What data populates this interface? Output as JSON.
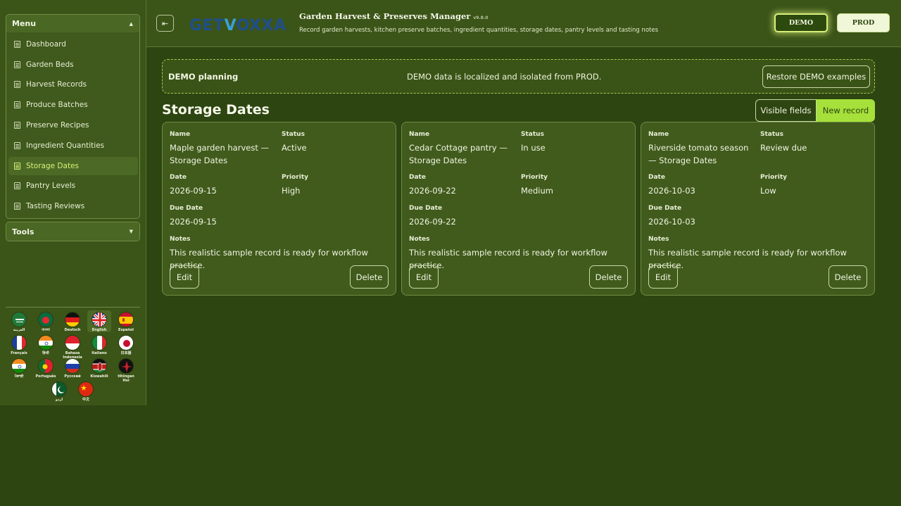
{
  "sidebar": {
    "menu_title": "Menu",
    "menu_items": [
      {
        "label": "Dashboard"
      },
      {
        "label": "Garden Beds"
      },
      {
        "label": "Harvest Records"
      },
      {
        "label": "Produce Batches"
      },
      {
        "label": "Preserve Recipes"
      },
      {
        "label": "Ingredient Quantities"
      },
      {
        "label": "Storage Dates",
        "active": true
      },
      {
        "label": "Pantry Levels"
      },
      {
        "label": "Tasting Reviews"
      }
    ],
    "tools_title": "Tools",
    "languages": [
      {
        "label": "العربية",
        "flag": "saudi-arabia"
      },
      {
        "label": "বাংলা",
        "flag": "bangladesh"
      },
      {
        "label": "Deutsch",
        "flag": "germany"
      },
      {
        "label": "English",
        "flag": "united-kingdom",
        "selected": true
      },
      {
        "label": "Español",
        "flag": "spain"
      },
      {
        "label": "Français",
        "flag": "france"
      },
      {
        "label": "हिन्दी",
        "flag": "india"
      },
      {
        "label": "Bahasa Indonesia",
        "flag": "indonesia"
      },
      {
        "label": "Italiano",
        "flag": "italy"
      },
      {
        "label": "日本語",
        "flag": "japan"
      },
      {
        "label": "ਪੰਜਾਬੀ",
        "flag": "india"
      },
      {
        "label": "Português",
        "flag": "portugal"
      },
      {
        "label": "Русский",
        "flag": "russia"
      },
      {
        "label": "Kiswahili",
        "flag": "kenya"
      },
      {
        "label": "tlhIngan Hol",
        "flag": "klingon"
      },
      {
        "label": "اردو",
        "flag": "pakistan"
      },
      {
        "label": "中文",
        "flag": "china"
      }
    ]
  },
  "header": {
    "logo_prefix": "GET",
    "logo_v": "V",
    "logo_suffix": "OXXA",
    "title": "Garden Harvest & Preserves Manager",
    "version": "v9.8.0",
    "subtitle": "Record garden harvests, kitchen preserve batches, ingredient quantities, storage dates, pantry levels and tasting notes",
    "demo_label": "DEMO",
    "prod_label": "PROD"
  },
  "notice": {
    "title": "DEMO planning",
    "message": "DEMO data is localized and isolated from PROD.",
    "restore_label": "Restore DEMO examples"
  },
  "section": {
    "title": "Storage Dates",
    "visible_fields_label": "Visible fields",
    "new_record_label": "New record"
  },
  "field_labels": {
    "name": "Name",
    "status": "Status",
    "date": "Date",
    "priority": "Priority",
    "due_date": "Due Date",
    "notes": "Notes",
    "edit": "Edit",
    "delete": "Delete"
  },
  "records": [
    {
      "name": "Maple garden harvest — Storage Dates",
      "status": "Active",
      "date": "2026-09-15",
      "priority": "High",
      "due_date": "2026-09-15",
      "notes": "This realistic sample record is ready for workflow practice."
    },
    {
      "name": "Cedar Cottage pantry — Storage Dates",
      "status": "In use",
      "date": "2026-09-22",
      "priority": "Medium",
      "due_date": "2026-09-22",
      "notes": "This realistic sample record is ready for workflow practice."
    },
    {
      "name": "Riverside tomato season — Storage Dates",
      "status": "Review due",
      "date": "2026-10-03",
      "priority": "Low",
      "due_date": "2026-10-03",
      "notes": "This realistic sample record is ready for workflow practice."
    }
  ],
  "colors": {
    "background": "#2d4511",
    "panel": "#3b5418",
    "accent": "#a6e03a",
    "active_text": "#d8f07a"
  }
}
